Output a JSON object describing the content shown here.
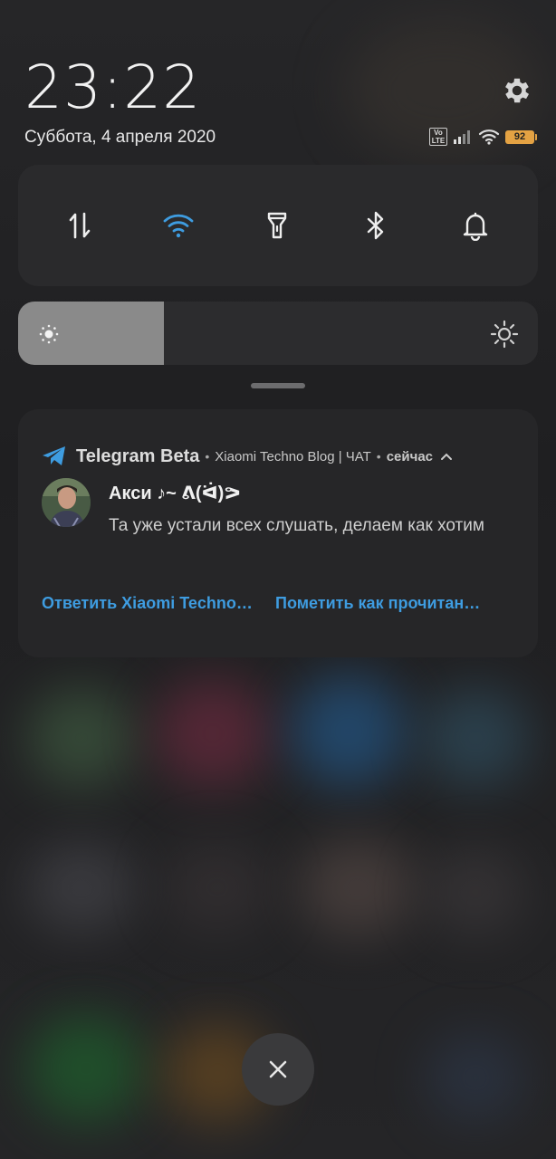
{
  "clock": {
    "time": "23:22",
    "date": "Суббота, 4 апреля 2020"
  },
  "status_bar": {
    "volte_label": "Vo LTE",
    "battery_level": "92"
  },
  "quick_settings": {
    "tiles": [
      {
        "icon": "mobile-data-icon",
        "active": false
      },
      {
        "icon": "wifi-icon",
        "active": true
      },
      {
        "icon": "flashlight-icon",
        "active": false
      },
      {
        "icon": "bluetooth-icon",
        "active": false
      },
      {
        "icon": "bell-icon",
        "active": false
      }
    ],
    "brightness_fraction": 0.28
  },
  "notification": {
    "app_name": "Telegram Beta",
    "subtext": "Xiaomi Techno Blog | ЧАТ",
    "time": "сейчас",
    "sender": "Акси ♪~ ᕕ(ᐛ)ᕗ",
    "message": "Та уже устали всех слушать, делаем как хотим",
    "actions": [
      "Ответить Xiaomi Techno…",
      "Пометить как прочитан…"
    ]
  },
  "colors": {
    "accent": "#3e9ce0",
    "battery": "#e4a243",
    "panel": "#2a2a2c"
  }
}
